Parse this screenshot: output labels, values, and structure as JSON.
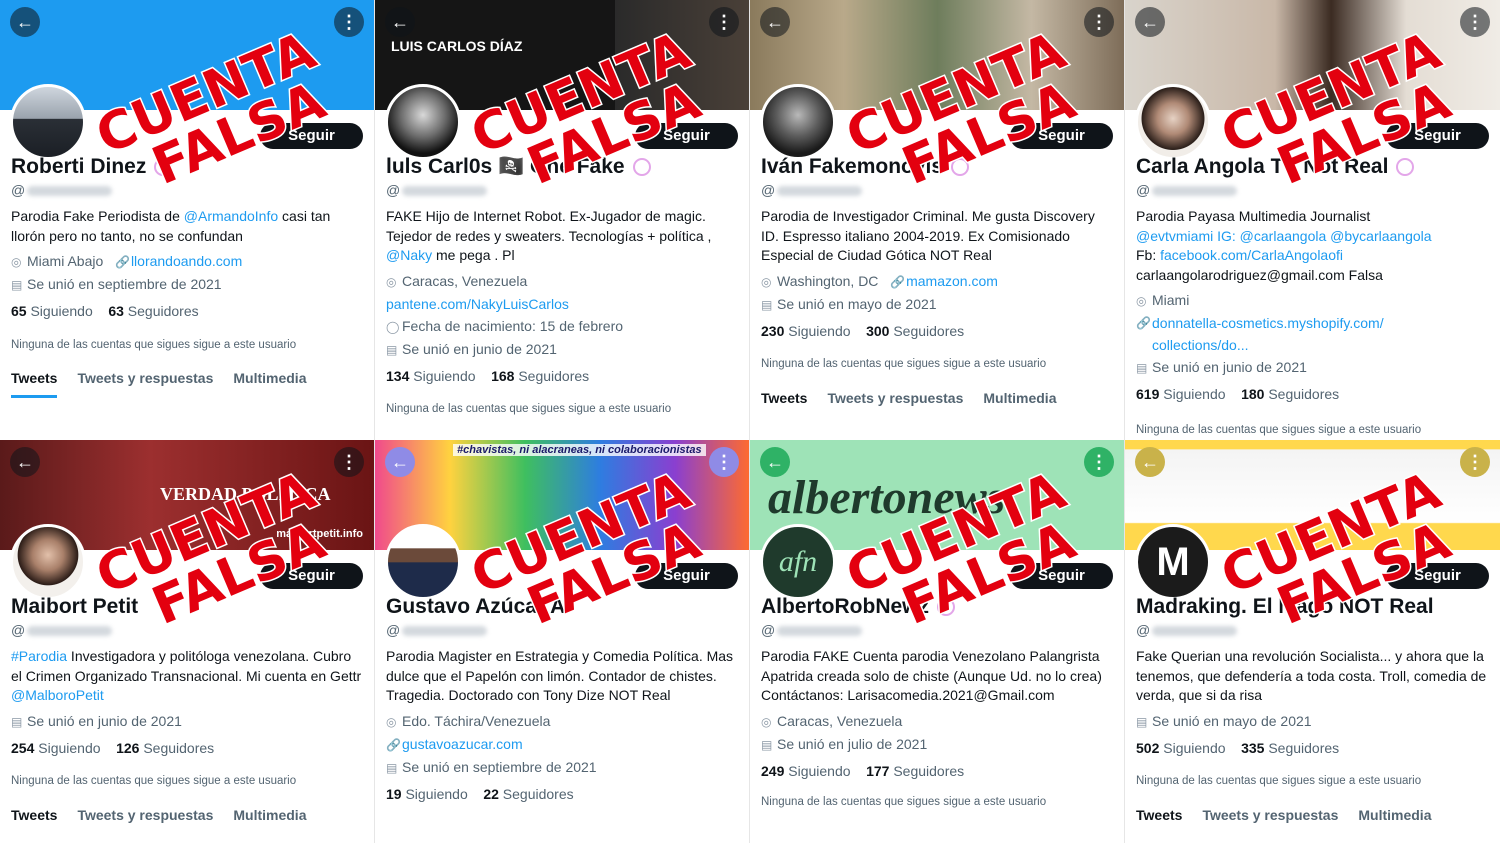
{
  "stamp": {
    "line1": "CUENTA",
    "line2": "FALSA"
  },
  "follow_label": "Seguir",
  "tabs": [
    "Tweets",
    "Tweets y respuestas",
    "Multimedia"
  ],
  "not_followed_note": "Ninguna de las cuentas que sigues sigue a este usuario",
  "colors": {
    "accent": "#1d9bf0",
    "stamp_red": "#e3000f",
    "button": "#0f1419"
  },
  "profiles": [
    {
      "name": "Roberti Dinez",
      "handle_prefix": "@",
      "bio_a": "Parodia Fake Periodista de ",
      "bio_link": "@ArmandoInfo",
      "bio_b": " casi tan llorón pero no tanto, no se confundan",
      "location": "Miami Abajo",
      "website": "llorandoando.com",
      "joined": "Se unió en septiembre de 2021",
      "following": "65",
      "following_label": "Siguiendo",
      "followers": "63",
      "followers_label": "Seguidores"
    },
    {
      "name": "luls Carl0s 🏴‍☠️ One Fake",
      "banner_text": "LUIS CARLOS DÍAZ",
      "handle_prefix": "@",
      "bio_a": "FAKE Hijo de Internet Robot. Ex-Jugador de magic. Tejedor de redes y sweaters. Tecnologías + política , ",
      "bio_link": "@Naky",
      "bio_b": " me pega . Pl",
      "location": "Caracas, Venezuela",
      "website": "pantene.com/NakyLuisCarlos",
      "birthday": "Fecha de nacimiento: 15 de febrero",
      "joined": "Se unió en junio de 2021",
      "following": "134",
      "following_label": "Siguiendo",
      "followers": "168",
      "followers_label": "Seguidores"
    },
    {
      "name": "Iván Fakemonovis",
      "handle_prefix": "@",
      "bio_a": "Parodia de Investigador Criminal. Me gusta Discovery ID. Espresso italiano 2004-2019.  Ex Comisionado Especial de Ciudad Gótica NOT Real",
      "location": "Washington, DC",
      "website": "mamazon.com",
      "joined": "Se unió en mayo de 2021",
      "following": "230",
      "following_label": "Siguiendo",
      "followers": "300",
      "followers_label": "Seguidores"
    },
    {
      "name": "Carla Angola TV Not Real",
      "handle_prefix": "@",
      "bio_a": "Parodia Payasa Multimedia Journalist",
      "bio_line2": "@evtvmiami IG: @carlaangola @bycarlaangola",
      "bio_line3_label": "Fb: ",
      "bio_line3_link": "facebook.com/CarlaAngolaofi",
      "bio_line4": "carlaangolarodriguez@gmail.com Falsa",
      "location": "Miami",
      "website": "donnatella-cosmetics.myshopify.com/ collections/do...",
      "joined": "Se unió en junio de 2021",
      "following": "619",
      "following_label": "Siguiendo",
      "followers": "180",
      "followers_label": "Seguidores"
    },
    {
      "name": "Maibort Petit",
      "banner_text": "VERDAD POLÍTICA",
      "banner_sub": "maibortpetit.info",
      "handle_prefix": "@",
      "bio_link": "#Parodia",
      "bio_a": " Investigadora y politóloga venezolana. Cubro el Crimen Organizado Transnacional. Mi cuenta en Gettr ",
      "bio_link2": "@MalboroPetit",
      "joined": "Se unió en junio de 2021",
      "following": "254",
      "following_label": "Siguiendo",
      "followers": "126",
      "followers_label": "Seguidores"
    },
    {
      "name": "Gustavo Azúcar A",
      "banner_text": "#chavistas, ni alacraneas, ni colaboracionistas",
      "handle_prefix": "@",
      "bio_a": "Parodia Magister en Estrategia y Comedia Política. Mas dulce que el Papelón con limón. Contador de chistes. Tragedia. Doctorado con Tony Dize NOT Real",
      "location": "Edo. Táchira/Venezuela",
      "website": "gustavoazucar.com",
      "joined": "Se unió en septiembre de 2021",
      "following": "19",
      "following_label": "Siguiendo",
      "followers": "22",
      "followers_label": "Seguidores"
    },
    {
      "name": "AlbertoRobNewz",
      "banner_text": "albertonews",
      "avatar_text": "afn",
      "handle_prefix": "@",
      "bio_a": "Parodia FAKE Cuenta parodia Venezolano Palangrista Apatrida  creada solo de chiste (Aunque Ud. no lo crea)  Contáctanos: Larisacomedia.2021@Gmail.com",
      "location": "Caracas, Venezuela",
      "joined": "Se unió en julio de 2021",
      "following": "249",
      "following_label": "Siguiendo",
      "followers": "177",
      "followers_label": "Seguidores"
    },
    {
      "name": "Madraking. El Mago NOT Real",
      "avatar_text": "M",
      "handle_prefix": "@",
      "bio_a": "Fake Querian una revolución Socialista... y ahora que la tenemos, que defendería a toda costa. Troll, comedia de verda, que si da risa",
      "joined": "Se unió en mayo de 2021",
      "following": "502",
      "following_label": "Siguiendo",
      "followers": "335",
      "followers_label": "Seguidores"
    }
  ]
}
